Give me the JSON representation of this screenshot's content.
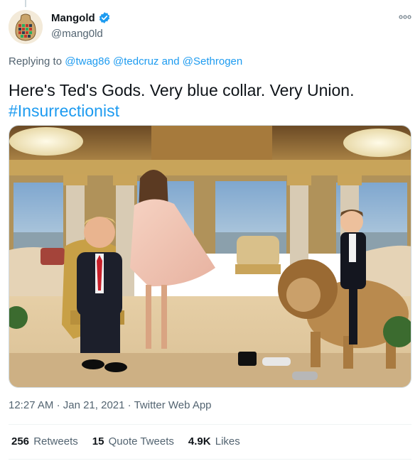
{
  "author": {
    "display_name": "Mangold",
    "handle": "@mang0ld",
    "verified": true
  },
  "reply": {
    "prefix": "Replying to",
    "mention_1": "@twag86",
    "mention_2": "@tedcruz",
    "joiner": "and",
    "mention_3": "@Sethrogen"
  },
  "tweet": {
    "text": "Here's Ted's Gods. Very blue collar. Very Union.",
    "hashtag": "#Insurrectionist"
  },
  "meta": {
    "time": "12:27 AM",
    "separator": "·",
    "date": "Jan 21, 2021",
    "app": "Twitter Web App"
  },
  "stats": {
    "retweets_count": "256",
    "retweets_label": "Retweets",
    "quotes_count": "15",
    "quotes_label": "Quote Tweets",
    "likes_count": "4.9K",
    "likes_label": "Likes"
  },
  "icons": {
    "verified": "verified-badge-icon",
    "more": "more-options-icon"
  },
  "colors": {
    "link": "#1d9bf0",
    "secondary_text": "#536471",
    "primary_text": "#0f1419"
  }
}
